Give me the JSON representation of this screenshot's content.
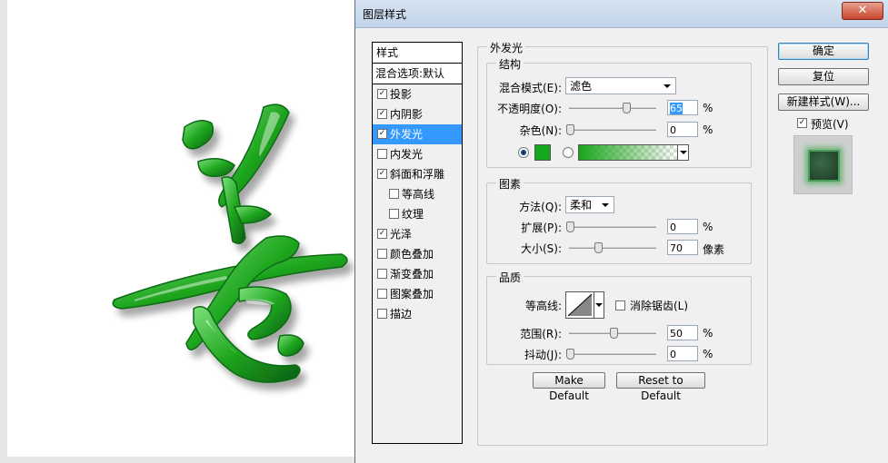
{
  "dialog": {
    "title": "图层样式",
    "close_label": "✕"
  },
  "styles_panel": {
    "header": "样式",
    "blend_options": "混合选项:默认",
    "items": [
      {
        "label": "投影",
        "checked": true,
        "sub": false,
        "active": false
      },
      {
        "label": "内阴影",
        "checked": true,
        "sub": false,
        "active": false
      },
      {
        "label": "外发光",
        "checked": true,
        "sub": false,
        "active": true
      },
      {
        "label": "内发光",
        "checked": false,
        "sub": false,
        "active": false
      },
      {
        "label": "斜面和浮雕",
        "checked": true,
        "sub": false,
        "active": false
      },
      {
        "label": "等高线",
        "checked": false,
        "sub": true,
        "active": false
      },
      {
        "label": "纹理",
        "checked": false,
        "sub": true,
        "active": false
      },
      {
        "label": "光泽",
        "checked": true,
        "sub": false,
        "active": false
      },
      {
        "label": "颜色叠加",
        "checked": false,
        "sub": false,
        "active": false
      },
      {
        "label": "渐变叠加",
        "checked": false,
        "sub": false,
        "active": false
      },
      {
        "label": "图案叠加",
        "checked": false,
        "sub": false,
        "active": false
      },
      {
        "label": "描边",
        "checked": false,
        "sub": false,
        "active": false
      }
    ]
  },
  "outer_glow": {
    "title": "外发光",
    "structure": {
      "title": "结构",
      "blend_mode_label": "混合模式(E):",
      "blend_mode_value": "滤色",
      "opacity_label": "不透明度(O):",
      "opacity_value": "65",
      "opacity_pct": 65,
      "noise_label": "杂色(N):",
      "noise_value": "0",
      "noise_pct": 0,
      "unit_percent": "%",
      "glow_color": "#14a91e"
    },
    "elements": {
      "title": "图素",
      "technique_label": "方法(Q):",
      "technique_value": "柔和",
      "spread_label": "扩展(P):",
      "spread_value": "0",
      "spread_pct": 0,
      "size_label": "大小(S):",
      "size_value": "70",
      "size_unit": "像素",
      "unit_percent": "%"
    },
    "quality": {
      "title": "品质",
      "contour_label": "等高线:",
      "antialias_label": "消除锯齿(L)",
      "range_label": "范围(R):",
      "range_value": "50",
      "range_pct": 50,
      "jitter_label": "抖动(J):",
      "jitter_value": "0",
      "jitter_pct": 0,
      "unit_percent": "%"
    },
    "make_default": "Make Default",
    "reset_default": "Reset to Default"
  },
  "buttons": {
    "ok": "确定",
    "reset": "复位",
    "new_style": "新建样式(W)...",
    "preview_label": "预览(V)"
  }
}
